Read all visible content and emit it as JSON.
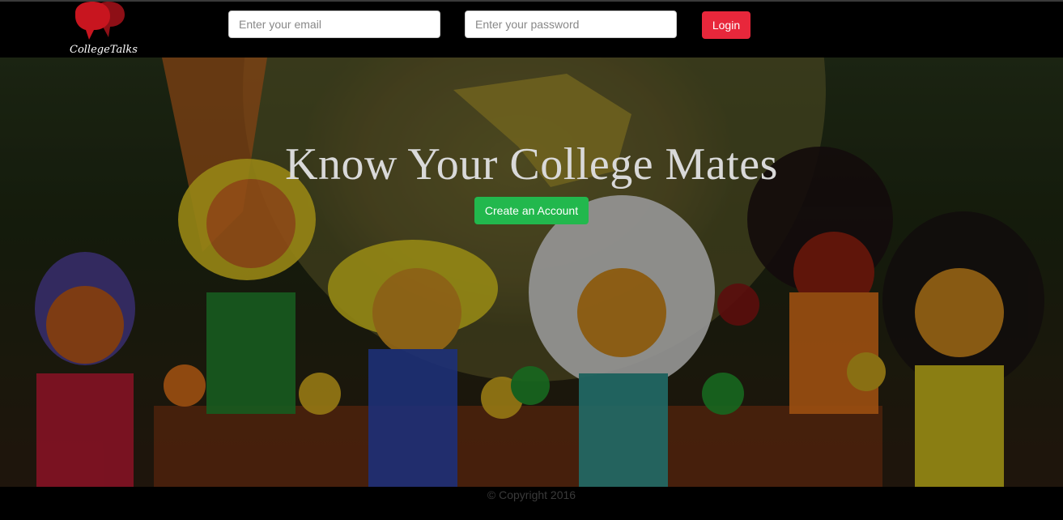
{
  "brand": {
    "name": "CollegeTalks"
  },
  "login": {
    "email_placeholder": "Enter your email",
    "password_placeholder": "Enter your password",
    "button_label": "Login"
  },
  "hero": {
    "title": "Know Your College Mates",
    "cta_label": "Create an Account"
  },
  "footer": {
    "copyright": "© Copyright 2016"
  },
  "colors": {
    "login_button": "#e8273b",
    "cta_button": "#22b84d",
    "logo_red": "#c8151f",
    "bar_background": "#000000"
  }
}
